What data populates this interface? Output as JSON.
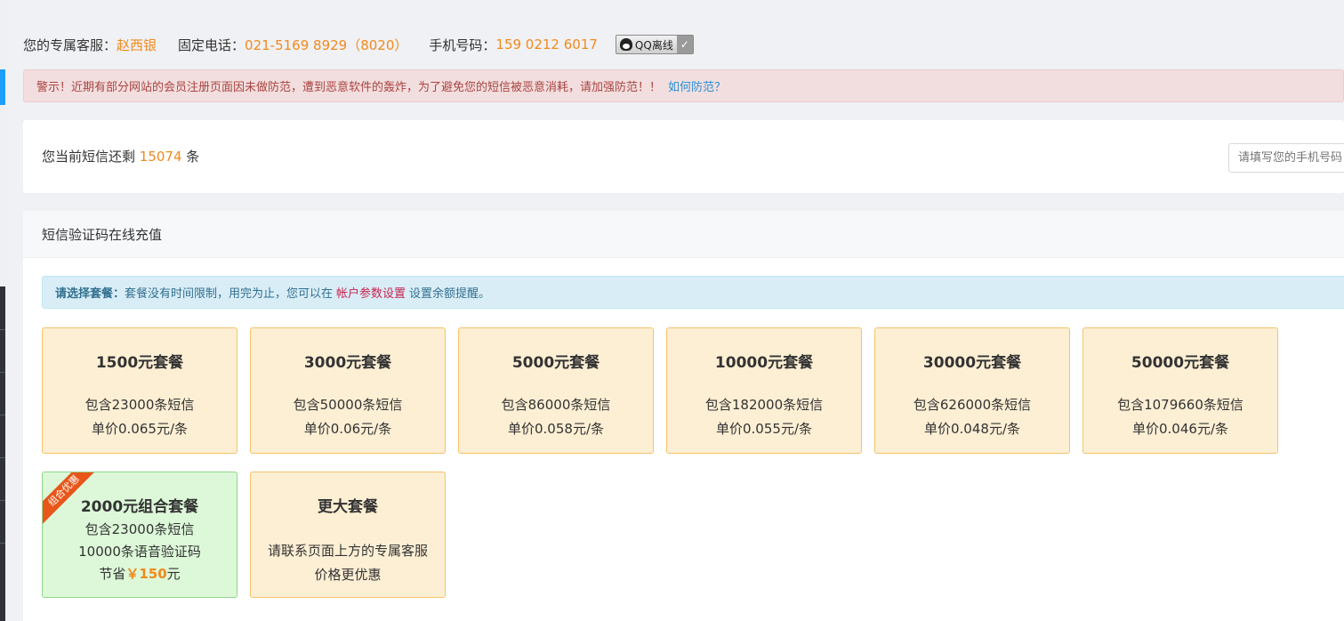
{
  "contact": {
    "service_label": "您的专属客服：",
    "service_name": "赵西银",
    "tel_label": "固定电话：",
    "tel_value": "021-5169 8929（8020）",
    "mobile_label": "手机号码：",
    "mobile_value": "159 0212 6017",
    "qq_label": "QQ离线",
    "qq_check": "✓"
  },
  "warning": {
    "text": "警示！近期有部分网站的会员注册页面因未做防范，遭到恶意软件的轰炸，为了避免您的短信被恶意消耗，请加强防范！！",
    "link": "如何防范？"
  },
  "balance": {
    "prefix": "您当前短信还剩",
    "count": "15074",
    "suffix": "条",
    "input_placeholder": "请填写您的手机号码"
  },
  "panel": {
    "title": "短信验证码在线充值",
    "info_bold": "请选择套餐：",
    "info_text": "套餐没有时间限制，用完为止，您可以在",
    "info_link": "帐户参数设置",
    "info_tail": "设置余额提醒。"
  },
  "packages": [
    {
      "title": "1500元套餐",
      "line1": "包含23000条短信",
      "line2": "单价0.065元/条"
    },
    {
      "title": "3000元套餐",
      "line1": "包含50000条短信",
      "line2": "单价0.06元/条"
    },
    {
      "title": "5000元套餐",
      "line1": "包含86000条短信",
      "line2": "单价0.058元/条"
    },
    {
      "title": "10000元套餐",
      "line1": "包含182000条短信",
      "line2": "单价0.055元/条"
    },
    {
      "title": "30000元套餐",
      "line1": "包含626000条短信",
      "line2": "单价0.048元/条"
    },
    {
      "title": "50000元套餐",
      "line1": "包含1079660条短信",
      "line2": "单价0.046元/条"
    }
  ],
  "combo": {
    "ribbon": "组合优惠",
    "title": "2000元组合套餐",
    "line1": "包含23000条短信",
    "line2": "10000条语音验证码",
    "save_prefix": "节省",
    "save_amount": "￥150",
    "save_suffix": "元"
  },
  "bigger": {
    "title": "更大套餐",
    "line1": "请联系页面上方的专属客服",
    "line2": "价格更优惠"
  },
  "colors": {
    "accent_orange": "#f08a1e",
    "warning_bg": "#f2dede",
    "info_bg": "#d9edf7",
    "card_bg": "#fdefd4",
    "combo_bg": "#dcf8d8"
  }
}
